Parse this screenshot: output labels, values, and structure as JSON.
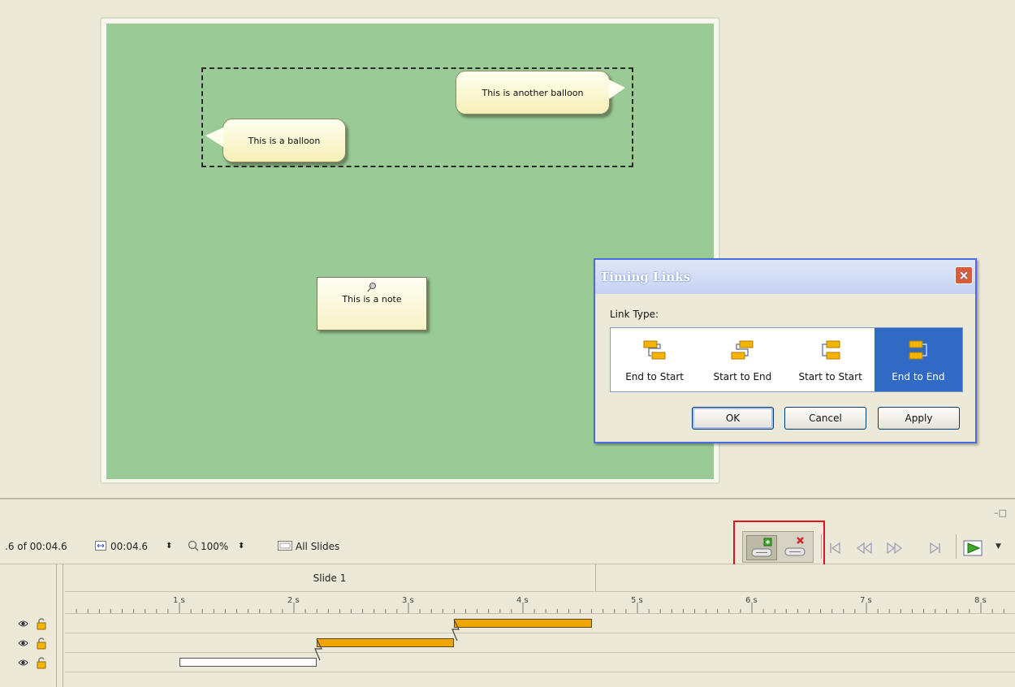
{
  "stage": {
    "balloon1": "This is a balloon",
    "balloon2": "This is another balloon",
    "note": "This is a note"
  },
  "dialog": {
    "title": "Timing Links",
    "close": "×",
    "link_type_label": "Link Type:",
    "options": [
      {
        "label": "End to Start",
        "icon": "end-to-start-icon",
        "selected": false
      },
      {
        "label": "Start to End",
        "icon": "start-to-end-icon",
        "selected": false
      },
      {
        "label": "Start to Start",
        "icon": "start-to-start-icon",
        "selected": false
      },
      {
        "label": "End to End",
        "icon": "end-to-end-icon",
        "selected": true
      }
    ],
    "buttons": {
      "ok": "OK",
      "cancel": "Cancel",
      "apply": "Apply"
    }
  },
  "timeline": {
    "window_controls": "–□",
    "time_position": ".6 of 00:04.6",
    "duration": "00:04.6",
    "zoom": "100%",
    "scope": "All Slides",
    "slide_label": "Slide 1",
    "ticks": [
      "1 s",
      "2 s",
      "3 s",
      "4 s",
      "5 s",
      "6 s",
      "7 s",
      "8 s"
    ],
    "tracks": [
      {
        "start_s": 3.4,
        "end_s": 4.6,
        "color": "#f0a500"
      },
      {
        "start_s": 2.2,
        "end_s": 3.4,
        "color": "#f0a500"
      },
      {
        "start_s": 1.0,
        "end_s": 2.2,
        "color": "#ffffff"
      }
    ],
    "transport_icons": [
      "skip-start-icon",
      "rewind-icon",
      "fast-forward-icon",
      "skip-end-icon",
      "play-icon"
    ],
    "highlight_color": "#e2141e"
  }
}
